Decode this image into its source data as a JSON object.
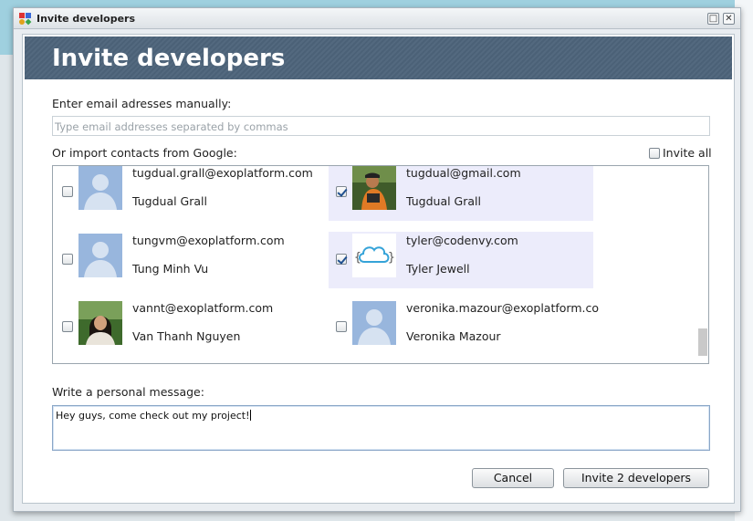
{
  "window": {
    "title": "Invite developers"
  },
  "banner": {
    "title": "Invite developers"
  },
  "manual": {
    "label": "Enter email adresses manually:",
    "placeholder": "Type email addresses separated by commas"
  },
  "google": {
    "label": "Or import contacts from Google:",
    "invite_all_label": "Invite all"
  },
  "contacts": [
    {
      "email": "tugdual.grall@exoplatform.com",
      "name": "Tugdual Grall",
      "checked": false,
      "avatar": "default-person-icon"
    },
    {
      "email": "tugdual@gmail.com",
      "name": "Tugdual Grall",
      "checked": true,
      "avatar": "photo"
    },
    {
      "email": "tungvm@exoplatform.com",
      "name": "Tung Minh Vu",
      "checked": false,
      "avatar": "default-person-icon"
    },
    {
      "email": "tyler@codenvy.com",
      "name": "Tyler Jewell",
      "checked": true,
      "avatar": "codenvy-cloud-logo"
    },
    {
      "email": "vannt@exoplatform.com",
      "name": "Van Thanh Nguyen",
      "checked": false,
      "avatar": "photo"
    },
    {
      "email": "veronika.mazour@exoplatform.co",
      "name": "Veronika Mazour",
      "checked": false,
      "avatar": "default-person-icon"
    }
  ],
  "message": {
    "label": "Write a personal message:",
    "value": "Hey guys, come check out my project!"
  },
  "buttons": {
    "cancel": "Cancel",
    "invite": "Invite 2 developers"
  },
  "colors": {
    "banner": "#4b6177",
    "selected_row": "#ececfb",
    "avatar_bg": "#98b6dd",
    "accent": "#1f4f8f"
  }
}
